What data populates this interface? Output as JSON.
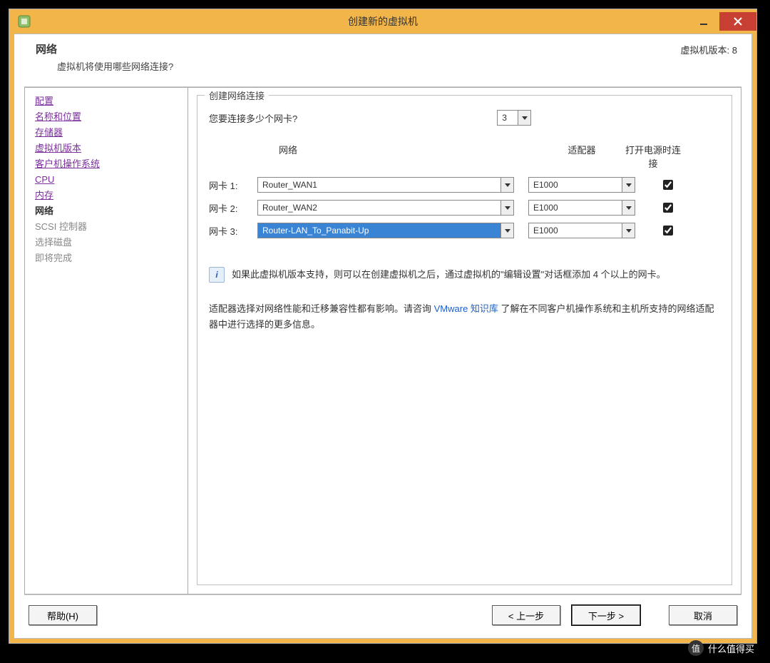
{
  "window": {
    "title": "创建新的虚拟机"
  },
  "header": {
    "title": "网络",
    "subtitle": "虚拟机将使用哪些网络连接?",
    "version_label": "虚拟机版本: 8"
  },
  "sidebar": {
    "items": [
      {
        "label": "配置",
        "state": "link"
      },
      {
        "label": "名称和位置",
        "state": "link"
      },
      {
        "label": "存储器",
        "state": "link"
      },
      {
        "label": "虚拟机版本",
        "state": "link"
      },
      {
        "label": "客户机操作系统",
        "state": "link"
      },
      {
        "label": "CPU",
        "state": "link"
      },
      {
        "label": "内存",
        "state": "link"
      },
      {
        "label": "网络",
        "state": "current"
      },
      {
        "label": "SCSI 控制器",
        "state": "disabled"
      },
      {
        "label": "选择磁盘",
        "state": "disabled"
      },
      {
        "label": "即将完成",
        "state": "disabled"
      }
    ]
  },
  "group": {
    "legend": "创建网络连接",
    "question": "您要连接多少个网卡?",
    "count_value": "3",
    "columns": {
      "network": "网络",
      "adapter": "适配器",
      "power_on": "打开电源时连接"
    },
    "nics": [
      {
        "label": "网卡 1:",
        "network": "Router_WAN1",
        "adapter": "E1000",
        "connect": true,
        "selected": false
      },
      {
        "label": "网卡 2:",
        "network": "Router_WAN2",
        "adapter": "E1000",
        "connect": true,
        "selected": false
      },
      {
        "label": "网卡 3:",
        "network": "Router-LAN_To_Panabit-Up",
        "adapter": "E1000",
        "connect": true,
        "selected": true
      }
    ],
    "info_text": "如果此虚拟机版本支持，则可以在创建虚拟机之后，通过虚拟机的\"编辑设置\"对话框添加 4 个以上的网卡。",
    "note_prefix": "适配器选择对网络性能和迁移兼容性都有影响。请咨询 ",
    "note_link": "VMware 知识库",
    "note_suffix": " 了解在不同客户机操作系统和主机所支持的网络适配器中进行选择的更多信息。"
  },
  "footer": {
    "help": "帮助(H)",
    "back": "< 上一步",
    "next": "下一步 >",
    "cancel": "取消"
  },
  "watermark": {
    "badge": "值",
    "text": "什么值得买"
  }
}
